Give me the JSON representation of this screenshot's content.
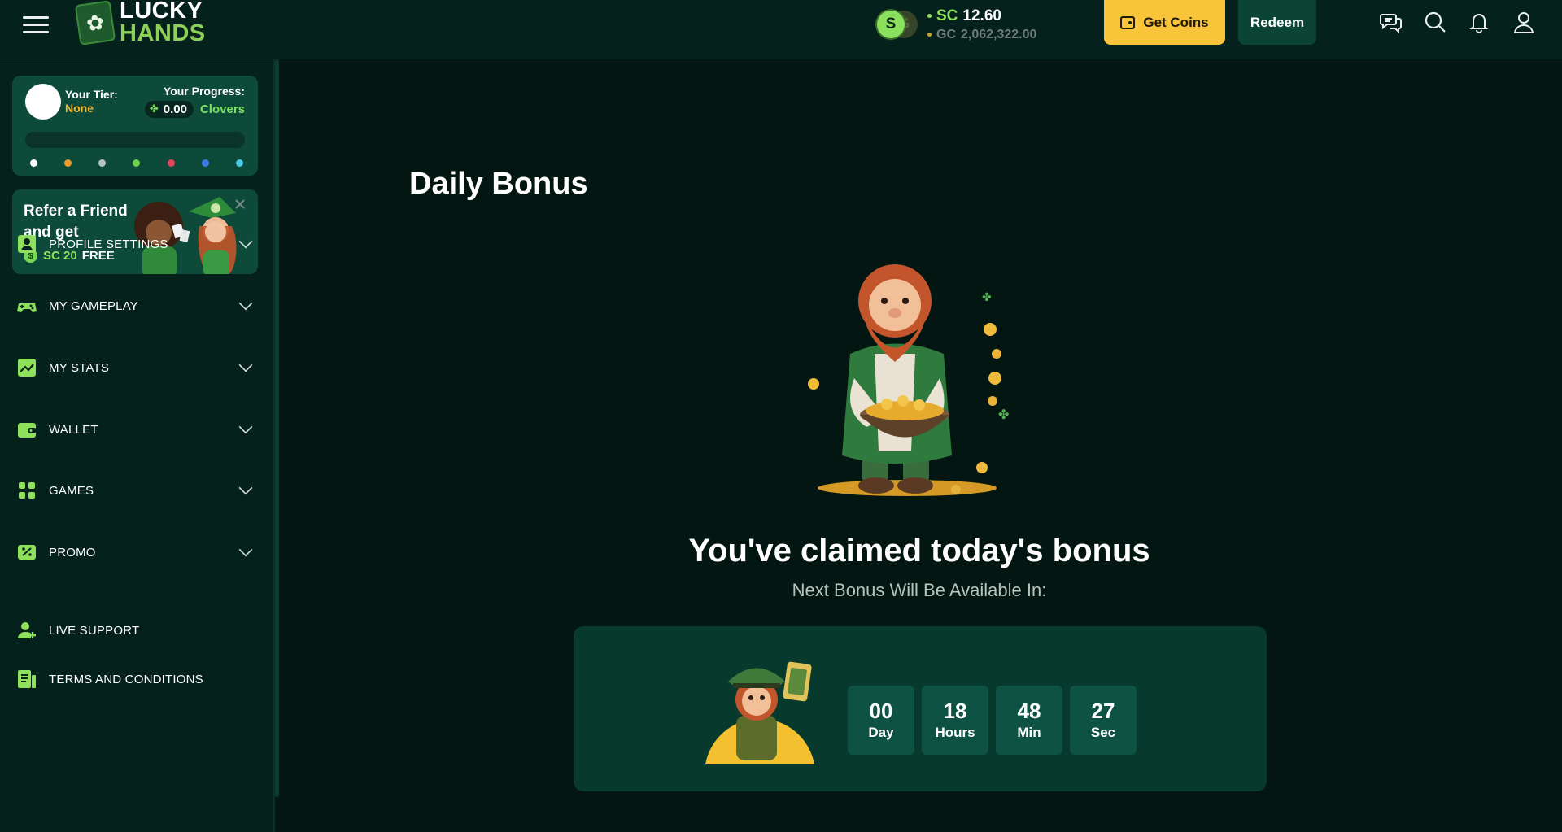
{
  "brand": {
    "line1": "LUCKY",
    "line2": "HANDS"
  },
  "header": {
    "sc_currency": "SC",
    "sc_amount": "12.60",
    "gc_currency": "GC",
    "gc_amount": "2,062,322.00",
    "coin_letter": "S",
    "get_coins_label": "Get Coins",
    "redeem_label": "Redeem",
    "icons": [
      "chat-icon",
      "search-icon",
      "bell-icon",
      "user-icon"
    ]
  },
  "tier": {
    "tier_label": "Your Tier:",
    "tier_value": "None",
    "progress_label": "Your Progress:",
    "progress_value": "0.00",
    "progress_unit": "Clovers",
    "progress_fraction": 0,
    "dot_colors": [
      "#ffffff",
      "#e89a2c",
      "#b9c2c0",
      "#6fd14a",
      "#e0455a",
      "#3a7ae8",
      "#49c8e8"
    ]
  },
  "refer": {
    "title": "Refer a Friend and get",
    "currency": "SC",
    "amount": "20",
    "free": "FREE"
  },
  "nav": {
    "items": [
      {
        "label": "PROFILE SETTINGS",
        "icon": "profile-icon"
      },
      {
        "label": "MY GAMEPLAY",
        "icon": "gamepad-icon"
      },
      {
        "label": "MY STATS",
        "icon": "stats-icon"
      },
      {
        "label": "WALLET",
        "icon": "wallet-icon"
      },
      {
        "label": "GAMES",
        "icon": "grid-icon"
      },
      {
        "label": "PROMO",
        "icon": "promo-icon"
      }
    ],
    "bottom": [
      {
        "label": "LIVE SUPPORT",
        "icon": "support-icon"
      },
      {
        "label": "TERMS AND CONDITIONS",
        "icon": "document-icon"
      }
    ]
  },
  "main": {
    "title": "Daily Bonus",
    "claimed": "You've claimed today's bonus",
    "next": "Next Bonus Will Be Available In:",
    "countdown": [
      {
        "value": "00",
        "unit": "Day"
      },
      {
        "value": "18",
        "unit": "Hours"
      },
      {
        "value": "48",
        "unit": "Min"
      },
      {
        "value": "27",
        "unit": "Sec"
      }
    ]
  },
  "colors": {
    "accent_green": "#8fe05b",
    "accent_yellow": "#f8c53a",
    "background": "#041612",
    "panel": "#0d4a3a"
  }
}
